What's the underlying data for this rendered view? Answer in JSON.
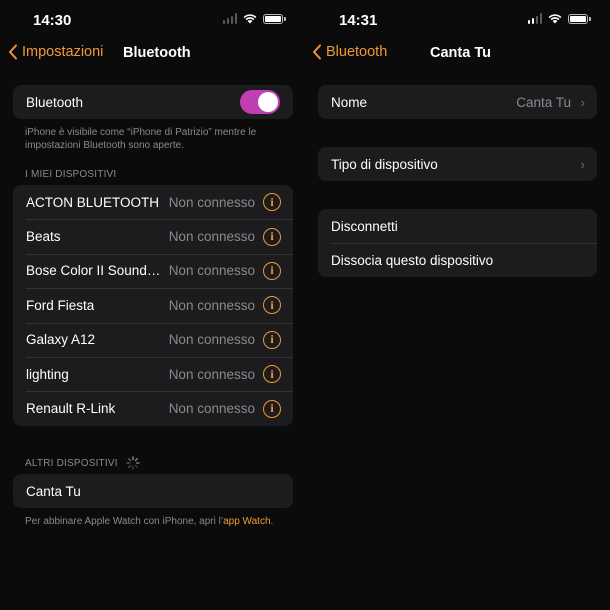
{
  "left": {
    "status_time": "14:30",
    "nav": {
      "back_label": "Impostazioni",
      "title": "Bluetooth"
    },
    "bluetooth_toggle": {
      "label": "Bluetooth",
      "state": "on",
      "color": "#bf3fb0"
    },
    "visibility_note": "iPhone è visibile come “iPhone di Patrizio” mentre le impostazioni Bluetooth sono aperte.",
    "my_devices_header": "I MIEI DISPOSITIVI",
    "my_devices": [
      {
        "name": "ACTON BLUETOOTH",
        "status": "Non connesso"
      },
      {
        "name": "Beats",
        "status": "Non connesso"
      },
      {
        "name": "Bose Color II SoundLink",
        "status": "Non connesso"
      },
      {
        "name": "Ford Fiesta",
        "status": "Non connesso"
      },
      {
        "name": "Galaxy A12",
        "status": "Non connesso"
      },
      {
        "name": "lighting",
        "status": "Non connesso"
      },
      {
        "name": "Renault R-Link",
        "status": "Non connesso"
      }
    ],
    "other_devices_header": "ALTRI DISPOSITIVI",
    "other_devices": [
      {
        "name": "Canta Tu"
      }
    ],
    "footer_text": "Per abbinare Apple Watch con iPhone, apri l’",
    "footer_link": "app Watch",
    "footer_end": "."
  },
  "right": {
    "status_time": "14:31",
    "nav": {
      "back_label": "Bluetooth",
      "title": "Canta Tu"
    },
    "name_row": {
      "label": "Nome",
      "value": "Canta Tu"
    },
    "type_row": {
      "label": "Tipo di dispositivo"
    },
    "actions": {
      "disconnect": "Disconnetti",
      "forget": "Dissocia questo dispositivo"
    }
  },
  "colors": {
    "accent": "#f0983a",
    "destructive": "#f0794a",
    "background": "#0b0b0b",
    "group": "#1c1c1e"
  }
}
